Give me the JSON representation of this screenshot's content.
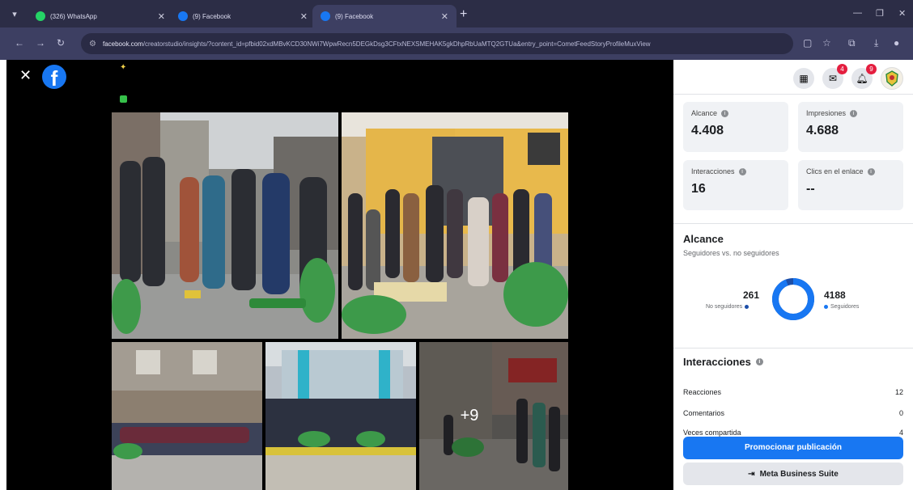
{
  "browser": {
    "tabs": [
      {
        "title": "(326) WhatsApp",
        "color": "#25d366"
      },
      {
        "title": "(9) Facebook",
        "color": "#1877f2"
      },
      {
        "title": "(9) Facebook",
        "color": "#1877f2"
      }
    ],
    "url_host": "facebook.com",
    "url_path": "/creatorstudio/insights/?content_id=pfbid02xdMBvKCD30NWi7WpwRecn5DEGkDsg3CFtxNEXSMEHAK5gkDhpRbUaMTQ2GTUa&entry_point=CometFeedStoryProfileMuxView"
  },
  "viewer": {
    "more_count": "+9"
  },
  "panel": {
    "badges": {
      "messenger": "4",
      "notifications": "9"
    },
    "stats": {
      "alcance_label": "Alcance",
      "alcance_value": "4.408",
      "impresiones_label": "Impresiones",
      "impresiones_value": "4.688",
      "interacciones_label": "Interacciones",
      "interacciones_value": "16",
      "clics_label": "Clics en el enlace",
      "clics_value": "--"
    },
    "reach": {
      "title": "Alcance",
      "subtitle": "Seguidores vs. no seguidores",
      "non_followers_value": "261",
      "non_followers_label": "No seguidores",
      "followers_value": "4188",
      "followers_label": "Seguidores",
      "followers_share": 0.941
    },
    "interactions": {
      "title": "Interacciones",
      "rows": [
        {
          "label": "Reacciones",
          "value": "12"
        },
        {
          "label": "Comentarios",
          "value": "0"
        },
        {
          "label": "Veces compartida",
          "value": "4"
        }
      ]
    },
    "buttons": {
      "promote": "Promocionar publicación",
      "meta_suite": "Meta Business Suite"
    }
  },
  "colors": {
    "facebook_blue": "#1877f2",
    "badge_red": "#e41e3f"
  }
}
